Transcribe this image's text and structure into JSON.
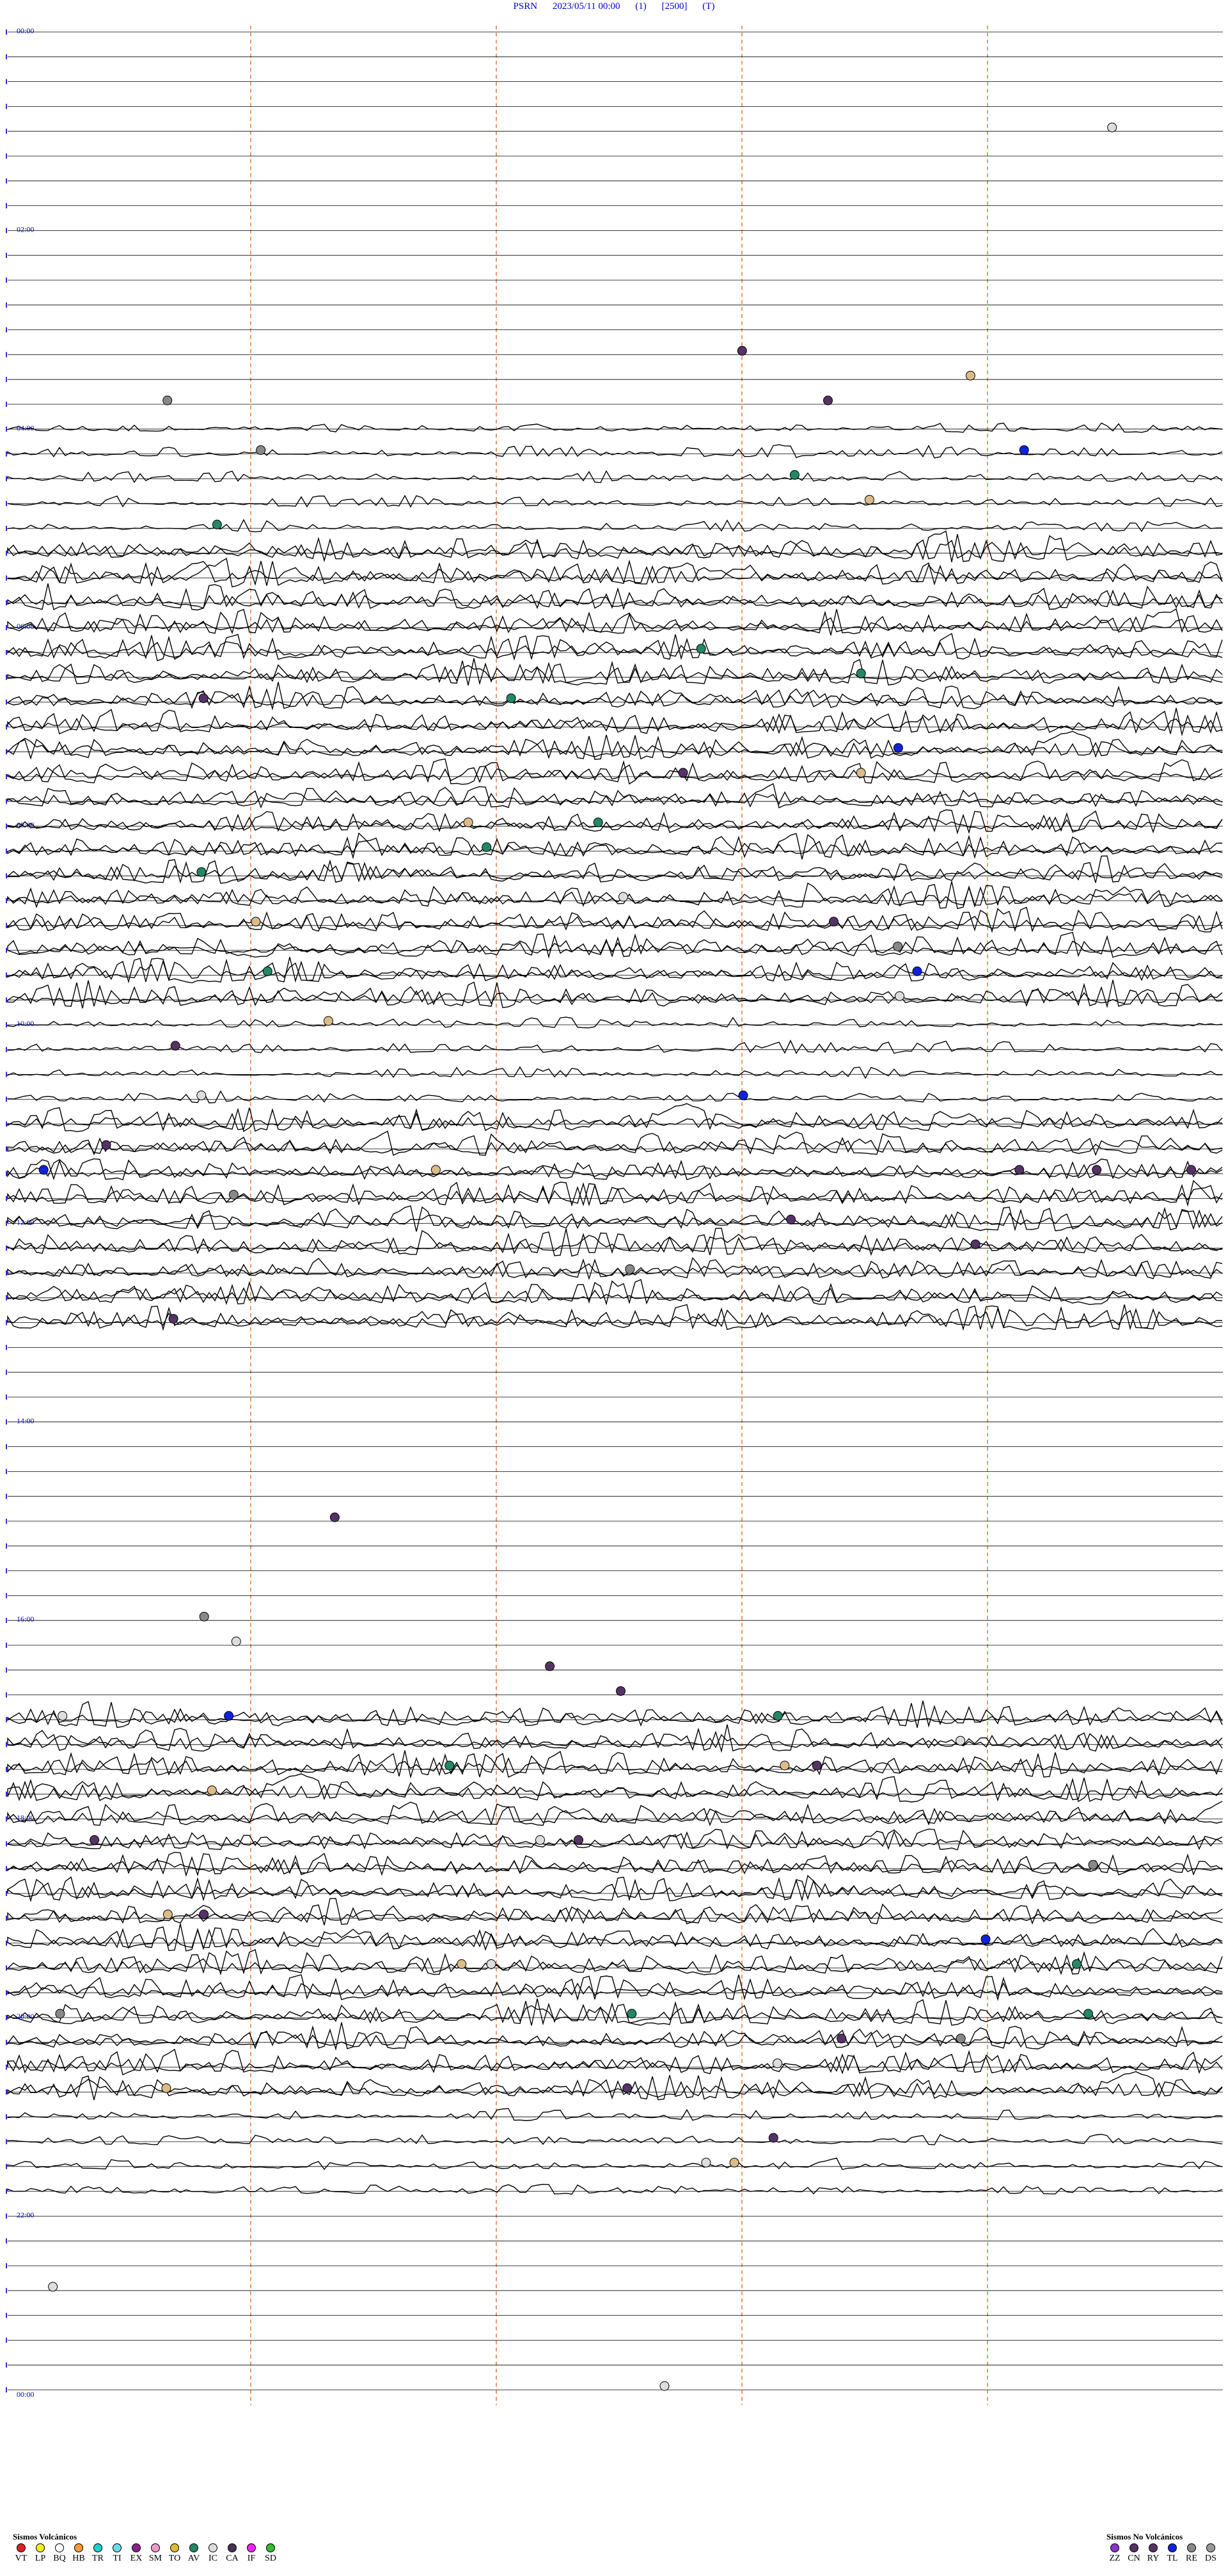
{
  "header": {
    "station": "PSRN",
    "datetime": "2023/05/11 00:00",
    "param1": "(1)",
    "param2": "[2500]",
    "param3": "(T)"
  },
  "chart_data": {
    "type": "line",
    "title": "PSRN 2023/05/11 00:00 (1) [2500] (T)",
    "hour_labels": [
      "00:00",
      "02:00",
      "04:00",
      "06:00",
      "08:00",
      "10:00",
      "12:00",
      "14:00",
      "16:00",
      "18:00",
      "20:00",
      "22:00",
      "00:00"
    ],
    "trace_count": 96,
    "activity_level": [
      1,
      1,
      1,
      1,
      1,
      1,
      1,
      1,
      1,
      1,
      1,
      1,
      1,
      1,
      1,
      1,
      2,
      2,
      2,
      2,
      2,
      3,
      3,
      3,
      3,
      3,
      3,
      3,
      3,
      3,
      3,
      3,
      3,
      3,
      3,
      3,
      3,
      3,
      3,
      3,
      2,
      2,
      2,
      2,
      3,
      3,
      3,
      3,
      3,
      3,
      3,
      3,
      3,
      1,
      1,
      1,
      1,
      1,
      1,
      1,
      1,
      1,
      1,
      1,
      1,
      1,
      1,
      1,
      3,
      3,
      3,
      3,
      3,
      3,
      3,
      3,
      3,
      3,
      3,
      3,
      3,
      3,
      3,
      3,
      2,
      2,
      2,
      2,
      1,
      1,
      1,
      1,
      1,
      1,
      1,
      1
    ],
    "grid": true
  },
  "legend": {
    "volcanic_title": "Sismos Volcánicos",
    "volcanic": [
      {
        "code": "VT",
        "color": "#dd2222"
      },
      {
        "code": "LP",
        "color": "#eeee22"
      },
      {
        "code": "BQ",
        "color": "#ffffff"
      },
      {
        "code": "HB",
        "color": "#ff9933"
      },
      {
        "code": "TR",
        "color": "#22cccc"
      },
      {
        "code": "TI",
        "color": "#66ddee"
      },
      {
        "code": "EX",
        "color": "#882288"
      },
      {
        "code": "SM",
        "color": "#ee99cc"
      },
      {
        "code": "TO",
        "color": "#ddbb33"
      },
      {
        "code": "AV",
        "color": "#228866"
      },
      {
        "code": "IC",
        "color": "#dddddd"
      },
      {
        "code": "CA",
        "color": "#443355"
      },
      {
        "code": "IF",
        "color": "#ee22ee"
      },
      {
        "code": "SD",
        "color": "#33bb33"
      }
    ],
    "nonvolcanic_title": "Sismos No Volcánicos",
    "nonvolcanic": [
      {
        "code": "ZZ",
        "color": "#8833cc"
      },
      {
        "code": "CN",
        "color": "#553366"
      },
      {
        "code": "RY",
        "color": "#553366"
      },
      {
        "code": "TL",
        "color": "#1122dd"
      },
      {
        "code": "RE",
        "color": "#888888"
      },
      {
        "code": "DS",
        "color": "#999999"
      }
    ]
  }
}
